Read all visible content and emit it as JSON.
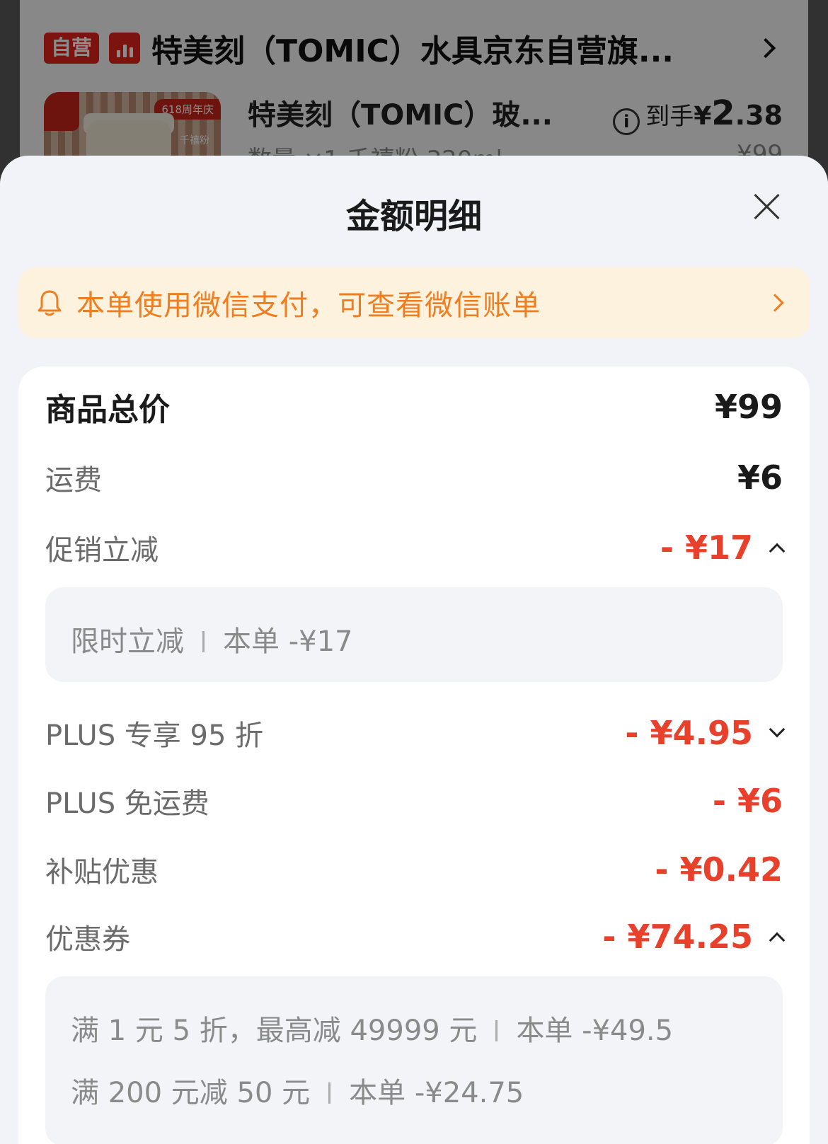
{
  "background": {
    "badge_self": "自营",
    "shop_name": "特美刻（TOMIC）水具京东自营旗...",
    "product_title": "特美刻（TOMIC）玻...",
    "thumb_tag": "618周年庆",
    "thumb_flavor": "千禧粉",
    "price_prefix": "到手",
    "price_yen": "¥",
    "price_int": "2",
    "price_dec": ".38",
    "sub_text": "数量 ×1  千禧粉 320ml",
    "orig_price": "¥99"
  },
  "sheet": {
    "title": "金额明细",
    "notice": {
      "text": "本单使用微信支付，可查看微信账单"
    },
    "rows": {
      "total": {
        "label": "商品总价",
        "amount": "¥99"
      },
      "shipping": {
        "label": "运费",
        "amount": "¥6"
      },
      "promo": {
        "label": "促销立减",
        "amount": "- ¥17"
      },
      "plus95": {
        "label": "PLUS 专享 95 折",
        "amount": "- ¥4.95"
      },
      "plusfree": {
        "label": "PLUS 免运费",
        "amount": "- ¥6"
      },
      "subsidy": {
        "label": "补贴优惠",
        "amount": "- ¥0.42"
      },
      "coupon": {
        "label": "优惠券",
        "amount": "- ¥74.25"
      }
    },
    "promo_details": [
      {
        "name": "限时立减",
        "amount": "本单 -¥17"
      }
    ],
    "coupon_details": [
      {
        "name": "满 1 元 5 折，最高减 49999 元",
        "amount": "本单 -¥49.5"
      },
      {
        "name": "满 200 元减 50 元",
        "amount": "本单 -¥24.75"
      }
    ]
  },
  "colors": {
    "accent_red": "#e8402a",
    "notice_orange": "#f07e20",
    "brand_red": "#e2231a"
  }
}
